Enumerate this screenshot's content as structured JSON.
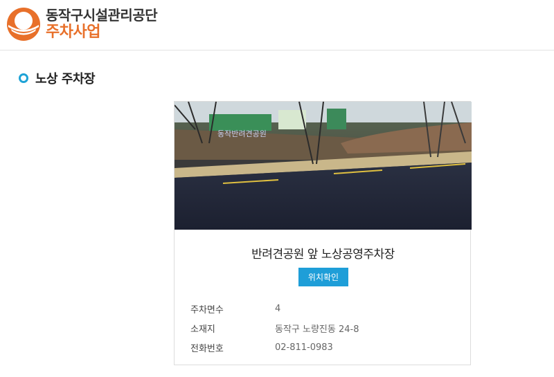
{
  "header": {
    "org_name": "동작구시설관리공단",
    "service_name": "주차사업",
    "brand_color": "#e8702a"
  },
  "page": {
    "title": "노상 주차장",
    "accent_color": "#1fa3d6"
  },
  "parking_lot": {
    "name": "반려견공원 앞 노상공영주차장",
    "map_button_label": "위치확인",
    "photo_sign_text": "동작반려견공원",
    "details": [
      {
        "label": "주차면수",
        "value": "4"
      },
      {
        "label": "소재지",
        "value": "동작구 노량진동 24-8"
      },
      {
        "label": "전화번호",
        "value": "02-811-0983"
      }
    ]
  }
}
